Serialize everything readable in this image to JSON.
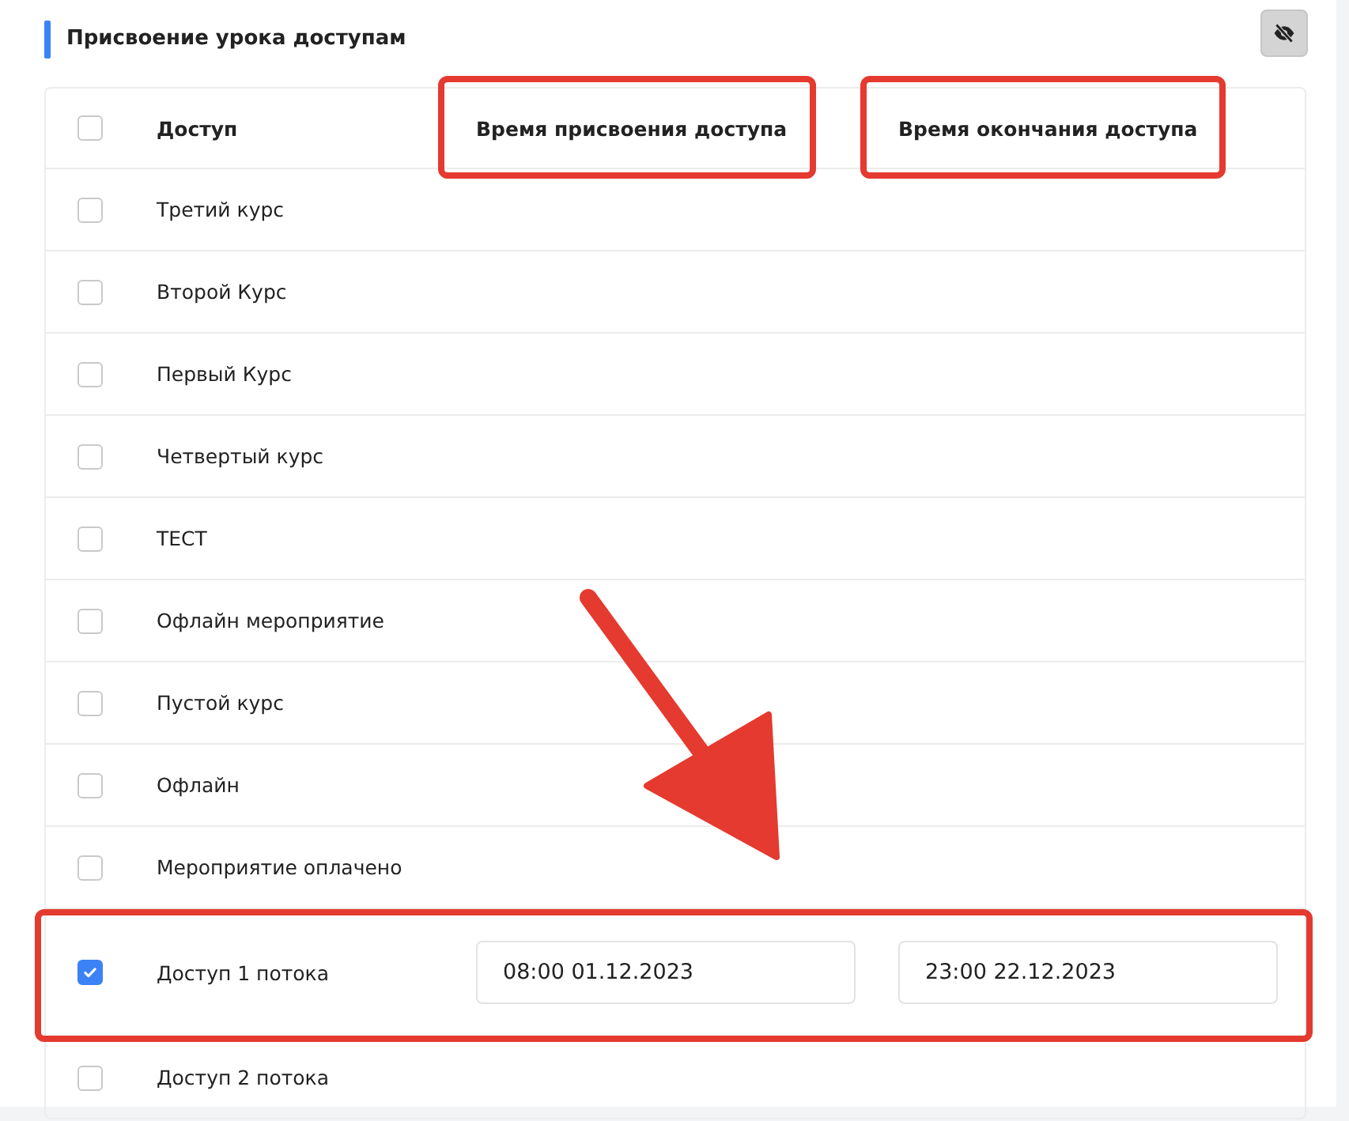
{
  "section": {
    "title": "Присвоение урока доступам",
    "visibility_button": {
      "hidden": true
    }
  },
  "table": {
    "select_all": {
      "checked": false
    },
    "columns": [
      {
        "label": "Доступ",
        "highlighted": false
      },
      {
        "label": "Время присвоения доступа",
        "highlighted": true
      },
      {
        "label": "Время окончания доступа",
        "highlighted": true
      }
    ],
    "rows": [
      {
        "label": "Третий курс",
        "checked": false,
        "highlighted": false
      },
      {
        "label": "Второй Курс",
        "checked": false,
        "highlighted": false
      },
      {
        "label": "Первый Курс",
        "checked": false,
        "highlighted": false
      },
      {
        "label": "Четвертый курс",
        "checked": false,
        "highlighted": false
      },
      {
        "label": "ТЕСТ",
        "checked": false,
        "highlighted": false
      },
      {
        "label": "Офлайн мероприятие",
        "checked": false,
        "highlighted": false
      },
      {
        "label": "Пустой курс",
        "checked": false,
        "highlighted": false
      },
      {
        "label": "Офлайн",
        "checked": false,
        "highlighted": false
      },
      {
        "label": "Мероприятие оплачено",
        "checked": false,
        "highlighted": false
      },
      {
        "label": "Доступ 1 потока",
        "checked": true,
        "highlighted": true,
        "start": "08:00 01.12.2023",
        "end": "23:00 22.12.2023"
      },
      {
        "label": "Доступ 2 потока",
        "checked": false,
        "highlighted": false
      }
    ]
  },
  "pointer_arrow": true
}
